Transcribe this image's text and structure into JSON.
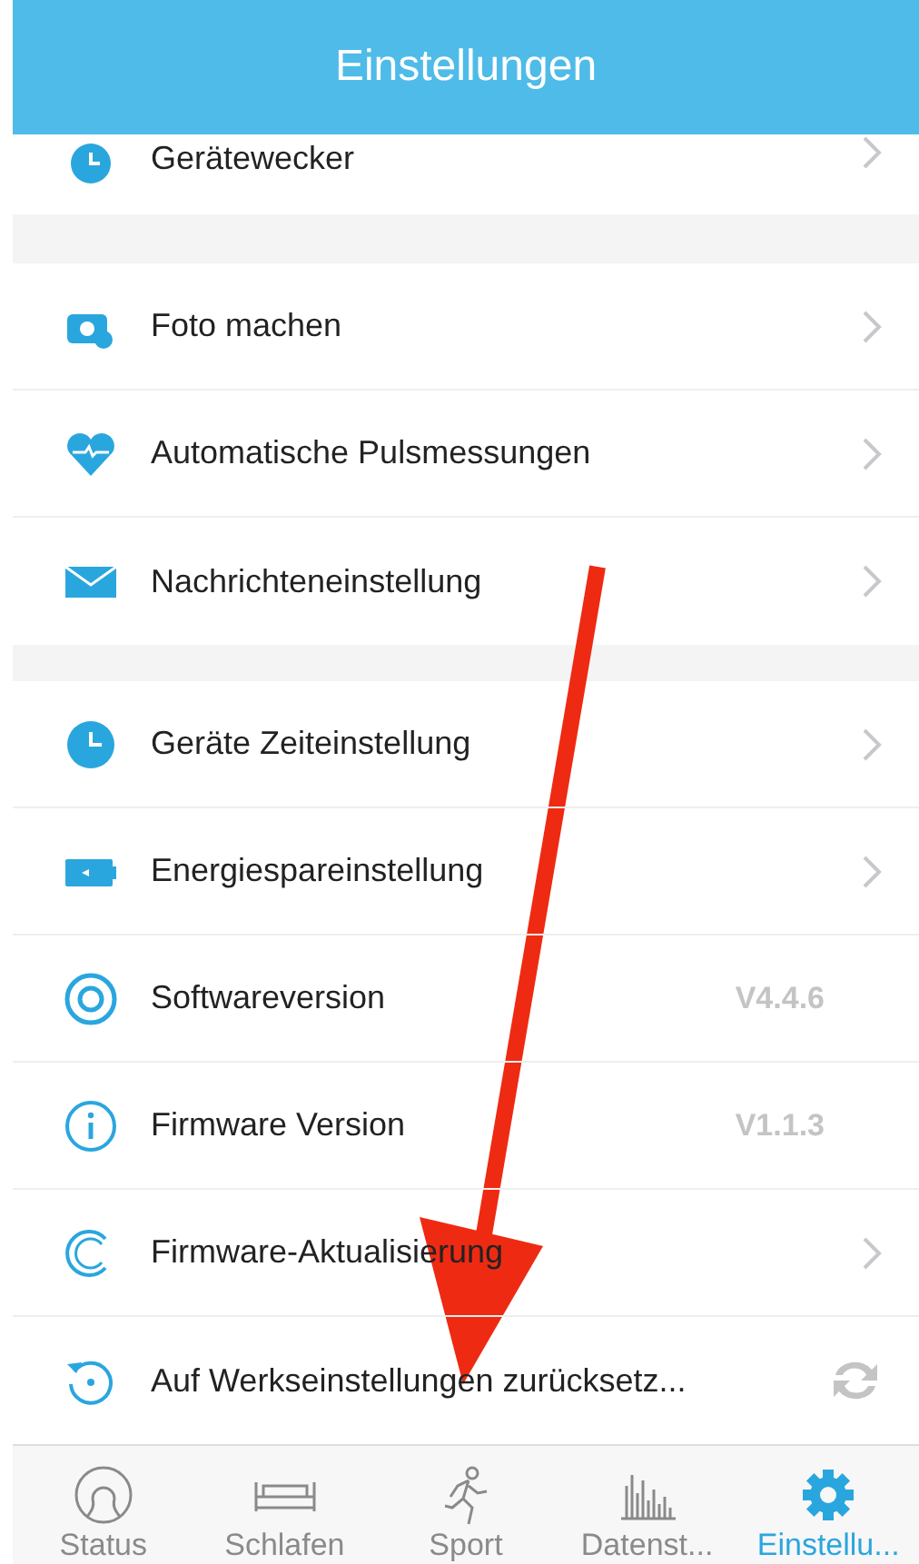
{
  "header": {
    "title": "Einstellungen"
  },
  "groups": [
    {
      "items": [
        {
          "label": "Gerätewecker",
          "kind": "chevron"
        }
      ]
    },
    {
      "items": [
        {
          "label": "Foto machen",
          "kind": "chevron"
        },
        {
          "label": "Automatische Pulsmessungen",
          "kind": "chevron"
        },
        {
          "label": "Nachrichteneinstellung",
          "kind": "chevron"
        }
      ]
    },
    {
      "items": [
        {
          "label": "Geräte Zeiteinstellung",
          "kind": "chevron"
        },
        {
          "label": "Energiespareinstellung",
          "kind": "chevron"
        },
        {
          "label": "Softwareversion",
          "kind": "value",
          "value": "V4.4.6"
        },
        {
          "label": "Firmware Version",
          "kind": "value",
          "value": "V1.1.3"
        },
        {
          "label": "Firmware-Aktualisierung",
          "kind": "chevron"
        },
        {
          "label": "Auf Werkseinstellungen zurücksetz...",
          "kind": "sync"
        }
      ]
    }
  ],
  "tabs": [
    {
      "label": "Status",
      "selected": false
    },
    {
      "label": "Schlafen",
      "selected": false
    },
    {
      "label": "Sport",
      "selected": false
    },
    {
      "label": "Datenst...",
      "selected": false
    },
    {
      "label": "Einstellu...",
      "selected": true
    }
  ]
}
